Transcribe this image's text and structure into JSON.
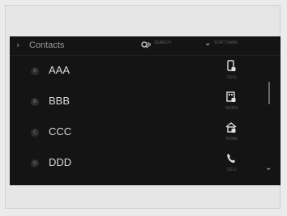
{
  "header": {
    "back_icon": "chevron-right",
    "title": "Contacts",
    "search": {
      "icon": "voice-search-icon",
      "label": "SEARCH"
    },
    "sort": {
      "icon": "chevron-down-icon",
      "label": "SORT NAME"
    }
  },
  "contacts": [
    {
      "initial": "A",
      "name": "AAA",
      "action_icon": "mobile-phone-icon",
      "action_label": "CELL"
    },
    {
      "initial": "B",
      "name": "BBB",
      "action_icon": "work-phone-icon",
      "action_label": "WORK"
    },
    {
      "initial": "C",
      "name": "CCC",
      "action_icon": "home-phone-icon",
      "action_label": "HOME"
    },
    {
      "initial": "D",
      "name": "DDD",
      "action_icon": "phone-handset-icon",
      "action_label": "CELL"
    }
  ],
  "scroll": {
    "down_icon": "chevron-down-icon"
  },
  "colors": {
    "screen_bg": "#141414",
    "text": "#d9d9d9",
    "muted": "#9a9a9a"
  }
}
